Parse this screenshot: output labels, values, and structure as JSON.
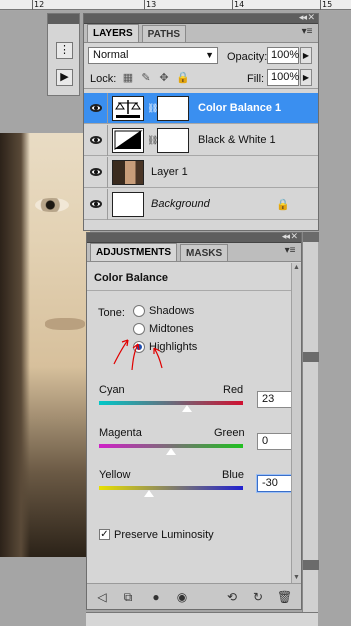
{
  "ruler": {
    "marks": [
      "12",
      "13",
      "14",
      "15"
    ]
  },
  "layers_panel": {
    "tabs": [
      {
        "label": "LAYERS",
        "active": true
      },
      {
        "label": "PATHS",
        "active": false
      }
    ],
    "blend_mode": "Normal",
    "opacity_label": "Opacity:",
    "opacity_value": "100%",
    "lock_label": "Lock:",
    "fill_label": "Fill:",
    "fill_value": "100%",
    "layers": [
      {
        "name": "Color Balance 1",
        "selected": true,
        "italic": false
      },
      {
        "name": "Black & White 1",
        "selected": false,
        "italic": false
      },
      {
        "name": "Layer 1",
        "selected": false,
        "italic": false
      },
      {
        "name": "Background",
        "selected": false,
        "italic": true,
        "locked": true
      }
    ]
  },
  "adjustments_panel": {
    "tabs": [
      {
        "label": "ADJUSTMENTS",
        "active": true
      },
      {
        "label": "MASKS",
        "active": false
      }
    ],
    "title": "Color Balance",
    "tone_label": "Tone:",
    "tone_options": [
      {
        "label": "Shadows",
        "checked": false
      },
      {
        "label": "Midtones",
        "checked": false
      },
      {
        "label": "Highlights",
        "checked": true
      }
    ],
    "sliders": [
      {
        "left": "Cyan",
        "right": "Red",
        "value": "23",
        "fraction": 0.61
      },
      {
        "left": "Magenta",
        "right": "Green",
        "value": "0",
        "fraction": 0.5
      },
      {
        "left": "Yellow",
        "right": "Blue",
        "value": "-30",
        "fraction": 0.35
      }
    ],
    "preserve_luminosity_label": "Preserve Luminosity",
    "preserve_luminosity_checked": true
  },
  "colors": {
    "selection": "#3a8ff0",
    "annotation": "#e00000"
  },
  "icons": {
    "footer": [
      "back-arrow-icon",
      "clip-layer-icon",
      "mask-toggle-icon",
      "visibility-icon",
      "previous-state-icon",
      "reset-icon",
      "delete-icon"
    ]
  }
}
